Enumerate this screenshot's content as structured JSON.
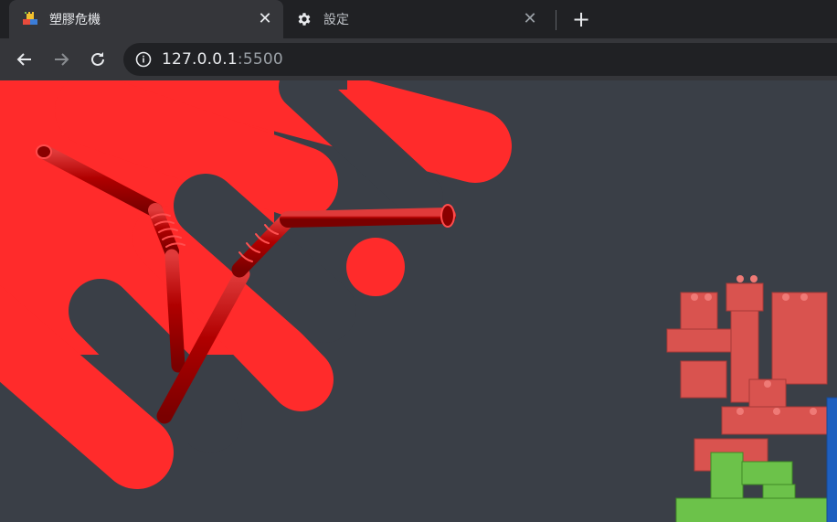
{
  "tabs": [
    {
      "title": "塑膠危機",
      "icon": "lego-blocks-icon",
      "active": true
    },
    {
      "title": "設定",
      "icon": "gear-icon",
      "active": false
    }
  ],
  "address_bar": {
    "host": "127.0.0.1",
    "port": ":5500"
  },
  "colors": {
    "page_bg": "#3a3f47",
    "accent_red": "#ff2b2b",
    "straw_red": "#c40000",
    "lego_red": "#d9534f",
    "lego_green": "#6cc24a",
    "lego_blue": "#1e5fbf"
  },
  "hero": {
    "image": "bent-straw-illustration",
    "side_image": "lego-block-characters"
  }
}
